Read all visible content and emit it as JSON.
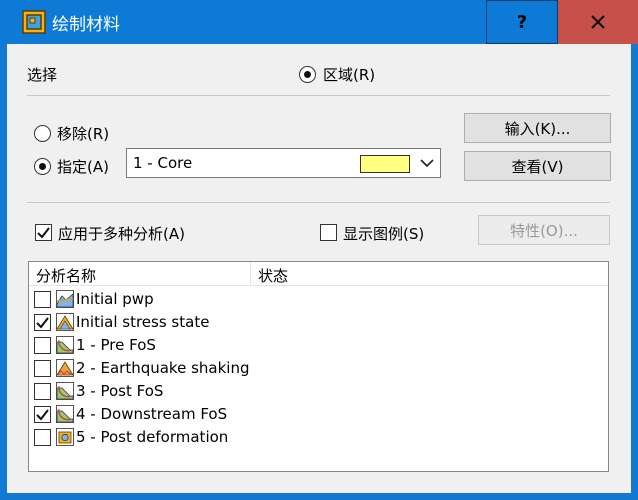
{
  "window": {
    "title": "绘制材料",
    "help_label": "?"
  },
  "selection": {
    "label": "选择",
    "region_option": "区域(R)"
  },
  "mode": {
    "remove_label": "移除(R)",
    "assign_label": "指定(A)",
    "material_value": "1 - Core",
    "material_color": "#ffff80"
  },
  "buttons": {
    "import_label": "输入(K)...",
    "view_label": "查看(V)",
    "properties_label": "特性(O)..."
  },
  "options": {
    "apply_multi_label": "应用于多种分析(A)",
    "show_legend_label": "显示图例(S)"
  },
  "list": {
    "headers": [
      "分析名称",
      "状态"
    ],
    "rows": [
      {
        "name": "Initial pwp",
        "checked": false,
        "icon": "pore-pressure-icon"
      },
      {
        "name": "Initial stress state",
        "checked": true,
        "icon": "stress-icon"
      },
      {
        "name": "1 - Pre FoS",
        "checked": false,
        "icon": "slope-stability-icon"
      },
      {
        "name": "2 - Earthquake shaking",
        "checked": false,
        "icon": "dynamic-icon"
      },
      {
        "name": "3 - Post FoS",
        "checked": false,
        "icon": "slope-stability-icon"
      },
      {
        "name": "4 - Downstream FoS",
        "checked": true,
        "icon": "slope-stability-icon"
      },
      {
        "name": "5 - Post deformation",
        "checked": false,
        "icon": "deformation-icon"
      }
    ]
  }
}
